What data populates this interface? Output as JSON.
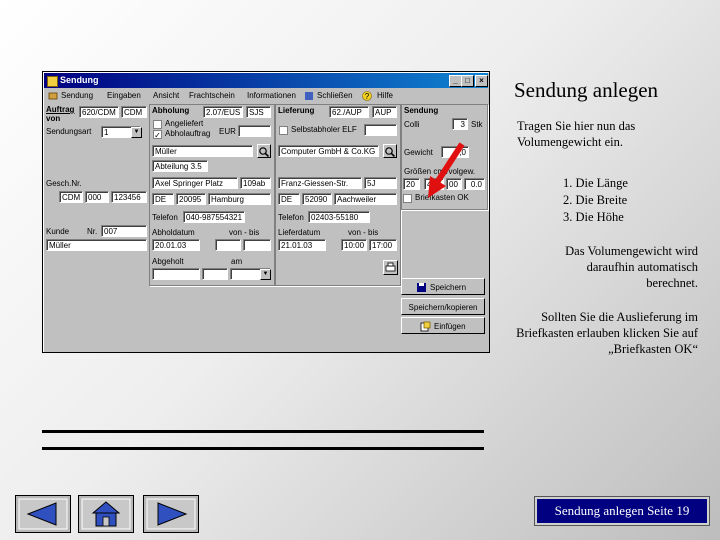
{
  "window": {
    "title": "Sendung",
    "menu": [
      "Sendung",
      "Eingaben",
      "Ansicht",
      "Frachtschein",
      "Informationen",
      "Schließen",
      "Hilfe"
    ]
  },
  "auftrag": {
    "label": "Auftrag",
    "von_label": "von",
    "code1": "620/CDM",
    "code2": "CDM",
    "sendungsart_label": "Sendungsart",
    "sendungsart_value": "1"
  },
  "abholung": {
    "label": "Abholung",
    "code1": "2.07/EUS",
    "code2": "SJS",
    "angeliefert_label": "Angeliefert",
    "abholauftrag_label": "Abholauftrag",
    "eur_label": "EUR",
    "name": "Müller",
    "abteilung": "Abteilung 3.5",
    "strasse": "Axel Springer Platz",
    "hausnr": "109ab",
    "land": "DE",
    "plz": "20095",
    "ort": "Hamburg",
    "telefon_label": "Telefon",
    "telefon": "040-987554321",
    "abholdatum_label": "Abholdatum",
    "von_bis_label": "von - bis",
    "abholdatum": "20.01.03",
    "abgeholt_label": "Abgeholt",
    "am_label": "am"
  },
  "lieferung": {
    "label": "Lieferung",
    "code1": "62./AUP",
    "code2": "AUP",
    "selbstabholer_label": "Selbstabholer ELF",
    "name": "Computer GmbH & Co.KG",
    "strasse": "Franz-Giessen-Str.",
    "hausnr": "5J",
    "land": "DE",
    "plz": "52090",
    "ort": "Aachweiler",
    "telefon_label": "Telefon",
    "telefon": "02403-55180",
    "lieferdatum_label": "Lieferdatum",
    "von_bis_label": "von - bis",
    "lieferdatum": "21.01.03",
    "von": "10:00",
    "bis": "17:00"
  },
  "kunde": {
    "gesch_label": "Gesch.Nr.",
    "gesch1": "CDM",
    "gesch2": "000",
    "gesch3": "123456",
    "kunde_label": "Kunde",
    "nr_label": "Nr.",
    "nr": "007",
    "name": "Müller"
  },
  "sendung": {
    "label": "Sendung",
    "colli_label": "Colli",
    "colli_value": "3",
    "stk_label": "Stk",
    "gewicht_label": "Gewicht",
    "gewicht_value": "0,0",
    "groessen_label": "Größen cm /volgew.",
    "g1": "20",
    "g2": "40",
    "g3": "00",
    "g4": "0.0",
    "briefkasten_label": "Briefkasten OK"
  },
  "buttons": {
    "speichern": "Speichern",
    "speichern_kopieren": "Speichern/kopieren",
    "einfuegen": "Einfügen"
  },
  "instructions": {
    "heading": "Sendung anlegen",
    "intro": "Tragen Sie hier nun das Volumengewicht ein.",
    "list": [
      "1. Die Länge",
      "2. Die Breite",
      "3. Die Höhe"
    ],
    "auto": "Das Volumengewicht wird daraufhin automatisch berechnet.",
    "briefkasten": "Sollten Sie die Auslieferung im Briefkasten erlauben klicken Sie auf „Briefkasten OK“"
  },
  "footer": {
    "label": "Sendung anlegen Seite 19"
  },
  "colors": {
    "arrow": "#e01010",
    "titlebar": "#000080",
    "footer_bg": "#000080"
  },
  "icons": [
    "app-icon",
    "search-icon",
    "help-icon",
    "save-icon",
    "insert-icon",
    "back-arrow-icon",
    "home-icon",
    "forward-arrow-icon"
  ]
}
